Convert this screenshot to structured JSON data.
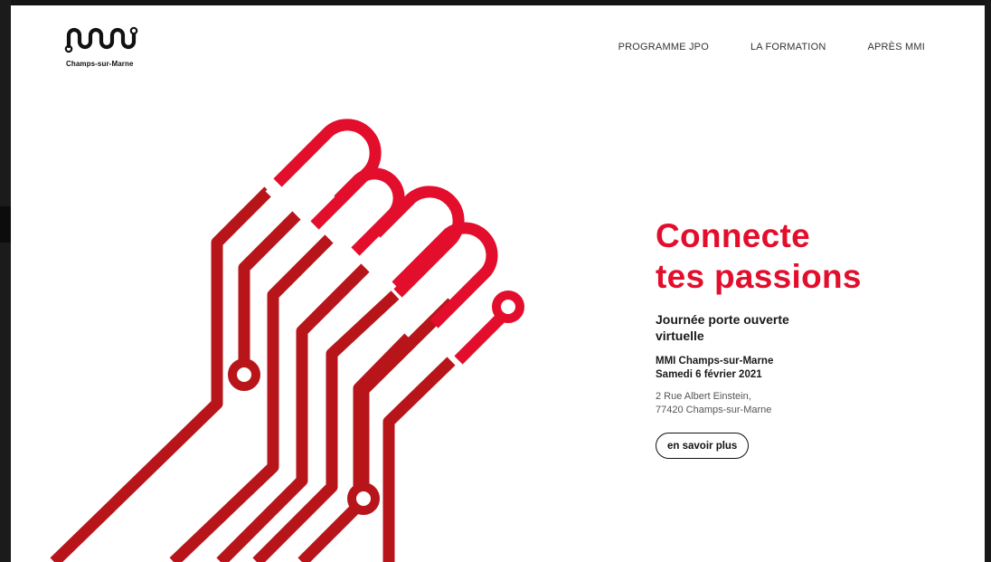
{
  "brand": {
    "logo_icon": "mmi-logo-icon",
    "caption": "Champs-sur-Marne"
  },
  "nav": {
    "items": [
      {
        "label": "PROGRAMME JPO"
      },
      {
        "label": "LA FORMATION"
      },
      {
        "label": "APRÈS MMI"
      }
    ]
  },
  "hero": {
    "title_line1": "Connecte",
    "title_line2": "tes passions",
    "subtitle": "Journée porte ouverte virtuelle",
    "event_line1": "MMI Champs-sur-Marne",
    "event_line2": "Samedi 6 février 2021",
    "address_line1": "2 Rue Albert Einstein,",
    "address_line2": "77420 Champs-sur-Marne",
    "cta_label": "en savoir plus"
  },
  "colors": {
    "accent_red": "#e30d2c",
    "dark_red": "#b8151b",
    "text_dark": "#1a1a1a"
  }
}
